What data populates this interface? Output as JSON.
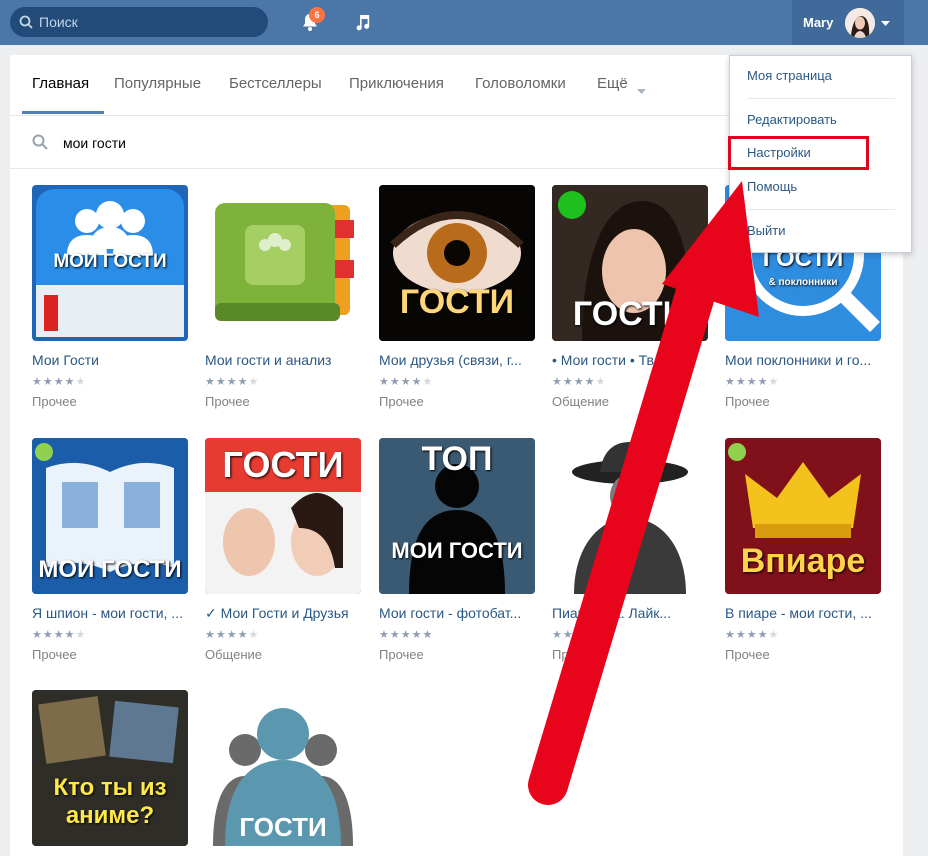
{
  "header": {
    "search_placeholder": "Поиск",
    "notifications_count": "6",
    "user_name": "Mary"
  },
  "tabs": [
    "Главная",
    "Популярные",
    "Бестселлеры",
    "Приключения",
    "Головоломки",
    "Ещё"
  ],
  "search": {
    "query": "мои гости"
  },
  "apps": [
    {
      "title": "Мои Гости",
      "rating": 4,
      "category": "Прочее",
      "thumb_text": "МОИ ГОСТИ"
    },
    {
      "title": "Мои гости и анализ",
      "rating": 4,
      "category": "Прочее",
      "thumb_text": ""
    },
    {
      "title": "Мои друзья (связи, г...",
      "rating": 4,
      "category": "Прочее",
      "thumb_text": "ГОСТИ"
    },
    {
      "title": "• Мои гости • Тв...",
      "rating": 4,
      "category": "Общение",
      "thumb_text": "ГОСТИ"
    },
    {
      "title": "Мои поклонники и го...",
      "rating": 4,
      "category": "Прочее",
      "thumb_text": "ГОСТИ"
    },
    {
      "title": "Я шпион - мои гости, ...",
      "rating": 4,
      "category": "Прочее",
      "thumb_text": "МОИ ГОСТИ"
    },
    {
      "title": "✓ Мои Гости и Друзья",
      "rating": 4,
      "category": "Общение",
      "thumb_text": "ГОСТИ"
    },
    {
      "title": "Мои гости - фотобат...",
      "rating": 5,
      "category": "Прочее",
      "thumb_text": "МОИ ГОСТИ"
    },
    {
      "title": "Пиар...жка. Лайк...",
      "rating": 4,
      "category": "Пр...",
      "thumb_text": ""
    },
    {
      "title": "В пиаре - мои гости, ...",
      "rating": 4,
      "category": "Прочее",
      "thumb_text": "Впиаре"
    },
    {
      "title": "",
      "rating": 0,
      "category": "",
      "thumb_text": "Кто ты из аниме?"
    },
    {
      "title": "",
      "rating": 0,
      "category": "",
      "thumb_text": "ГОСТИ"
    }
  ],
  "thumb_extra": {
    "thumb_5_subtitle": "& поклонники",
    "thumb_8_top": "ТОП"
  },
  "dropdown": {
    "my_page": "Моя страница",
    "edit": "Редактировать",
    "settings": "Настройки",
    "help": "Помощь",
    "logout": "Выйти"
  },
  "colors": {
    "header": "#4a76a8",
    "link": "#2a5885",
    "highlight": "#e0051f",
    "arrow": "#e8051c"
  }
}
